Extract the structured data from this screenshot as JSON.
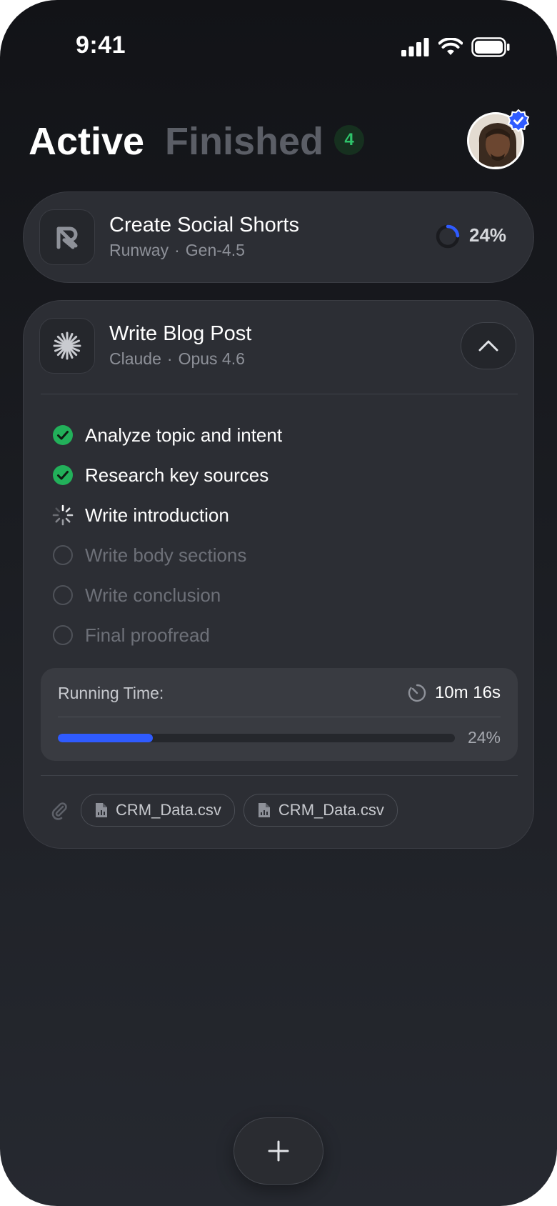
{
  "status_bar": {
    "time": "9:41"
  },
  "header": {
    "tab_active": "Active",
    "tab_finished": "Finished",
    "finished_count": "4"
  },
  "tasks": [
    {
      "title": "Create Social Shorts",
      "provider": "Runway",
      "model": "Gen-4.5",
      "progress_label": "24%",
      "progress": 0.24
    },
    {
      "title": "Write Blog Post",
      "provider": "Claude",
      "model": "Opus 4.6",
      "steps": [
        {
          "label": "Analyze topic and intent",
          "state": "done"
        },
        {
          "label": "Research key sources",
          "state": "done"
        },
        {
          "label": "Write introduction",
          "state": "in-progress"
        },
        {
          "label": "Write body sections",
          "state": "pending"
        },
        {
          "label": "Write conclusion",
          "state": "pending"
        },
        {
          "label": "Final proofread",
          "state": "pending"
        }
      ],
      "running_time_label": "Running Time:",
      "running_time": "10m 16s",
      "progress_label": "24%",
      "progress": 0.24,
      "attachments": [
        "CRM_Data.csv",
        "CRM_Data.csv"
      ]
    }
  ],
  "colors": {
    "accent_blue": "#2f5bff",
    "success_green": "#22b05a",
    "badge_green": "#2ec36a",
    "background": "#1b1d22"
  },
  "icons": {
    "runway": "runway-logo-icon",
    "claude": "claude-sparkle-icon",
    "collapse": "chevron-up-icon",
    "timer": "timer-icon",
    "attach": "paperclip-icon",
    "file": "file-icon",
    "add": "plus-icon"
  }
}
